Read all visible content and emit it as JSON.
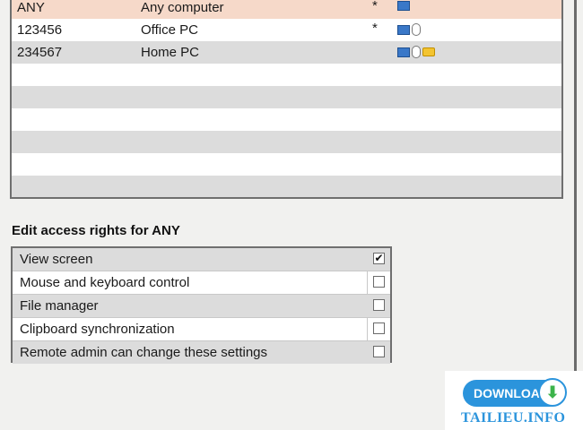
{
  "computers": {
    "rows": [
      {
        "id": "ANY",
        "name": "Any computer",
        "flag": "*",
        "icons": [
          "monitor-icon"
        ]
      },
      {
        "id": "123456",
        "name": "Office PC",
        "flag": "*",
        "icons": [
          "monitor-icon",
          "mouse-icon"
        ]
      },
      {
        "id": "234567",
        "name": "Home PC",
        "flag": "",
        "icons": [
          "monitor-icon",
          "mouse-icon",
          "folder-icon"
        ]
      }
    ]
  },
  "rights": {
    "title": "Edit access rights for ANY",
    "items": [
      {
        "label": "View screen",
        "checked": true
      },
      {
        "label": "Mouse and keyboard control",
        "checked": false
      },
      {
        "label": "File manager",
        "checked": false
      },
      {
        "label": "Clipboard synchronization",
        "checked": false
      },
      {
        "label": "Remote admin can change these settings",
        "checked": false
      }
    ]
  },
  "colors": {
    "selected_row": "#f6d9c9",
    "alt_row": "#dcdcdc",
    "badge_blue": "#2b94dc"
  },
  "badge": {
    "download_label": "DOWNLOAD",
    "site": "TAILIEU.INFO"
  }
}
